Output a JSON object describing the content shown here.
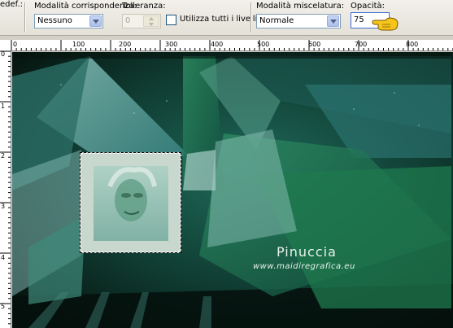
{
  "toolbar": {
    "cut_label": "edef.:",
    "match_mode": {
      "label": "Modalità corrispondenza:",
      "value": "Nessuno"
    },
    "tolerance": {
      "label": "Tolleranza:",
      "value": "0"
    },
    "use_all_layers": {
      "label": "Utilizza tutti i livelli",
      "checked": false
    },
    "blend_mode": {
      "label": "Modalità miscelatura:",
      "value": "Normale"
    },
    "opacity": {
      "label": "Opacità:",
      "value": "75"
    }
  },
  "ruler_top_labels": [
    "0",
    "100",
    "200",
    "300",
    "400",
    "500",
    "600",
    "700",
    "800"
  ],
  "ruler_left_labels": [
    "0",
    "1",
    "2",
    "3",
    "4",
    "5"
  ],
  "watermark": {
    "name": "Pinuccia",
    "site": "www.maidiregrafica.eu"
  },
  "colors": {
    "dark_green": "#0c2820",
    "teal": "#2f7a78",
    "light_teal": "#7fb3ae",
    "green": "#1f7a4e",
    "selection_fill": "#c9d8cf"
  }
}
